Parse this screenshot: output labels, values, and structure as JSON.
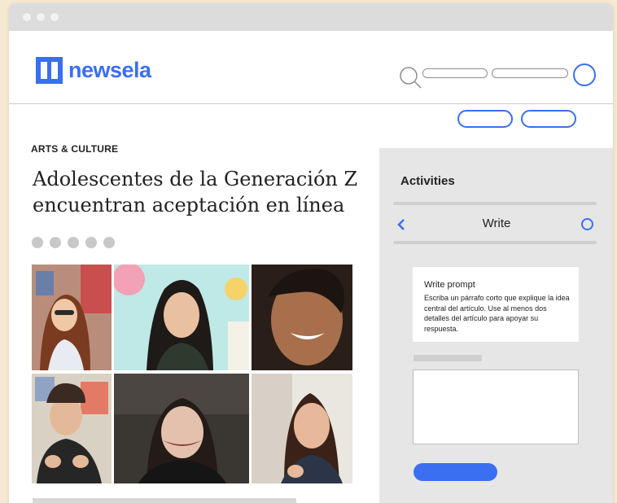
{
  "app": {
    "brand": "newsela",
    "colors": {
      "accent": "#3a6ff2",
      "page_background": "#f7e8d2",
      "sidebar": "#e6e6e6"
    }
  },
  "header": {
    "icons": [
      "newsela-logo-icon",
      "search-icon",
      "avatar-icon"
    ]
  },
  "article": {
    "category": "ARTS & CULTURE",
    "title": "Adolescentes de la Generación Z encuentran aceptación en línea",
    "image_count": 6
  },
  "sidebar": {
    "title": "Activities",
    "nav": {
      "back_icon": "chevron-left-icon",
      "label": "Write",
      "status_icon": "circle-icon"
    },
    "prompt": {
      "title": "Write prompt",
      "text": "Escriba un párrafo corto que explique la idea central del artículo. Use al menos dos detalles del artículo para apoyar su respuesta."
    }
  }
}
